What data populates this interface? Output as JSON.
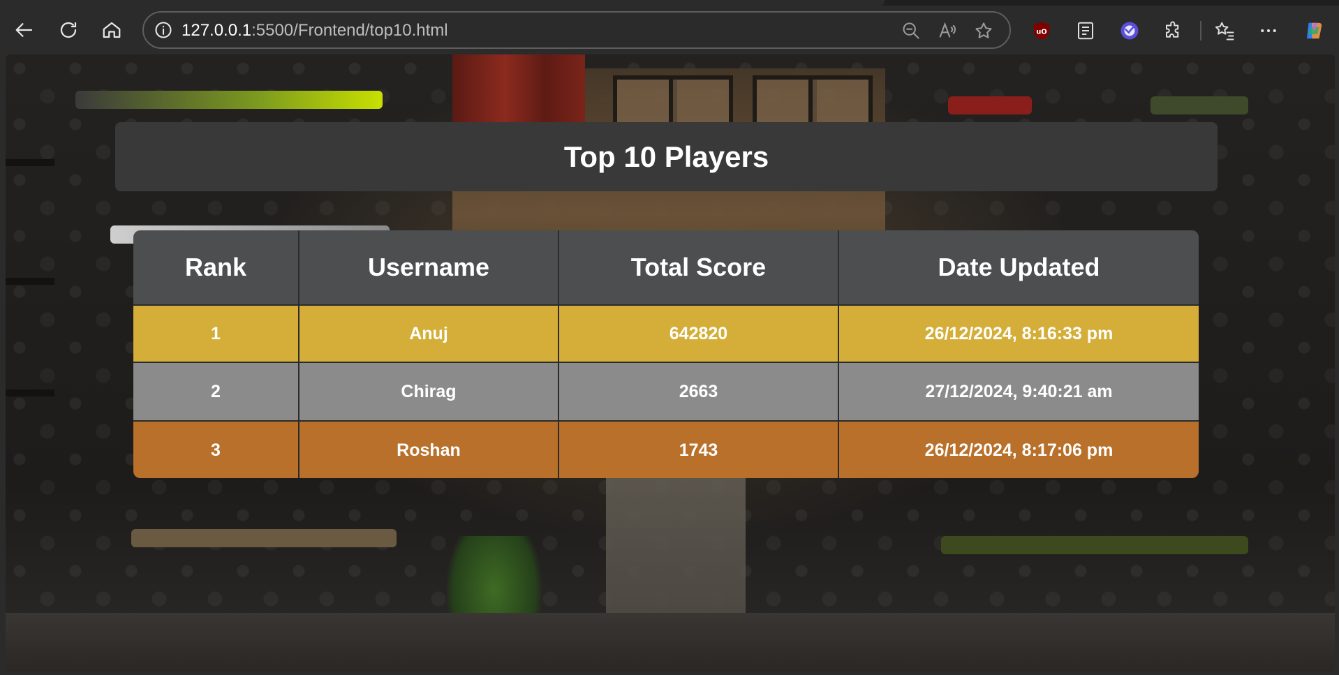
{
  "browser": {
    "url_host": "127.0.0.1",
    "url_rest": ":5500/Frontend/top10.html",
    "icons": [
      "back-icon",
      "refresh-icon",
      "home-icon",
      "site-info-icon",
      "zoom-out-icon",
      "read-aloud-icon",
      "favorite-star-icon",
      "ublock-icon",
      "reading-view-icon",
      "profile-extension-icon",
      "extensions-puzzle-icon",
      "favorites-icon",
      "more-options-icon",
      "copilot-icon"
    ]
  },
  "page": {
    "title": "Top 10 Players",
    "columns": [
      "Rank",
      "Username",
      "Total Score",
      "Date Updated"
    ],
    "rows": [
      {
        "rank": "1",
        "username": "Anuj",
        "score": "642820",
        "date": "26/12/2024, 8:16:33 pm",
        "color": "#d4ae38"
      },
      {
        "rank": "2",
        "username": "Chirag",
        "score": "2663",
        "date": "27/12/2024, 9:40:21 am",
        "color": "#8b8b8b"
      },
      {
        "rank": "3",
        "username": "Roshan",
        "score": "1743",
        "date": "26/12/2024, 8:17:06 pm",
        "color": "#b8702a"
      }
    ]
  }
}
